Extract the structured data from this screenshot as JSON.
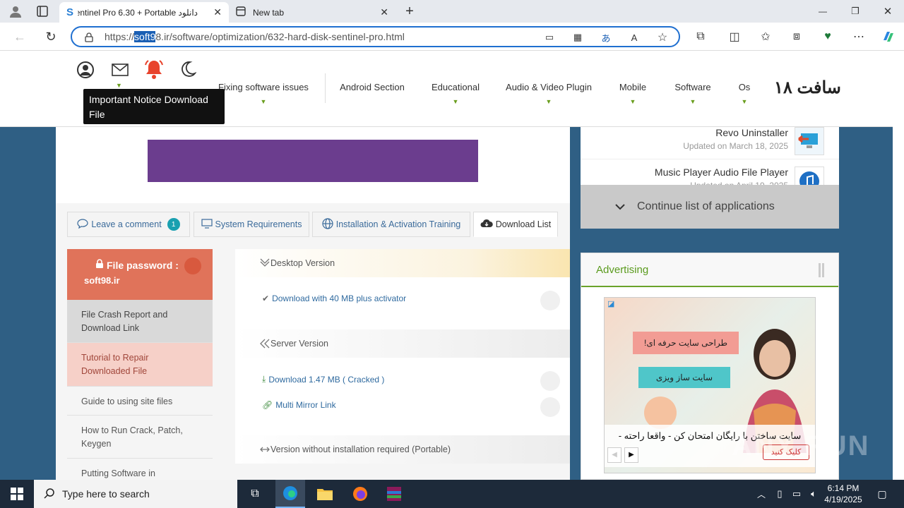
{
  "browser": {
    "tabs": [
      {
        "title": "دانلود Sentinel Pro 6.30 + Portable",
        "close": "✕"
      },
      {
        "title": "New tab",
        "close": "✕"
      }
    ],
    "url_prefix": "https://",
    "url_highlight": "soft9",
    "url_rest": "8.ir/software/optimization/632-hard-disk-sentinel-pro.html",
    "window_controls": [
      "—",
      "❐",
      "✕"
    ]
  },
  "site": {
    "logo": "سافت ۱۸",
    "nav": [
      "Os",
      "Software",
      "Mobile",
      "Audio & Video Plugin",
      "Educational",
      "Android Section",
      "Fixing software issues"
    ],
    "tooltip": "Important Notice Download File"
  },
  "content_tabs": [
    {
      "label": "Leave a comment",
      "badge": "1"
    },
    {
      "label": "System Requirements"
    },
    {
      "label": "Installation & Activation Training"
    },
    {
      "label": "Download List"
    }
  ],
  "password": {
    "label": "File password :",
    "value": "soft98.ir"
  },
  "side_links": [
    "File Crash Report and Download Link",
    "Tutorial to Repair Downloaded File",
    "Guide to using site files",
    "How to Run Crack, Patch, Keygen",
    "Putting Software in"
  ],
  "sections": [
    {
      "title": "Desktop Version",
      "links": [
        "Download with 40 MB plus activator"
      ]
    },
    {
      "title": "Server Version",
      "links": [
        "Download 1.47 MB ( Cracked )",
        "Multi Mirror Link"
      ]
    },
    {
      "title": "Version without installation required (Portable)",
      "links": []
    }
  ],
  "right": {
    "apps": [
      {
        "name": "Revo Uninstaller",
        "date": "Updated on March 18, 2025"
      },
      {
        "name": "Music Player Audio File Player",
        "date": "Updated on April 19, 2025"
      }
    ],
    "continue": "Continue list of applications",
    "advertising": "Advertising",
    "ad_line1": "طراحی سایت حرفه ای!",
    "ad_line2": "سایت ساز ویزی",
    "ad_caption": "سایت ساختن با رایگان امتحان کن - واقعا راحته -",
    "ad_button": "کلیک کنید",
    "watermark": "ANY RUN"
  },
  "taskbar": {
    "search": "Type here to search",
    "time": "6:14 PM",
    "date": "4/19/2025"
  }
}
